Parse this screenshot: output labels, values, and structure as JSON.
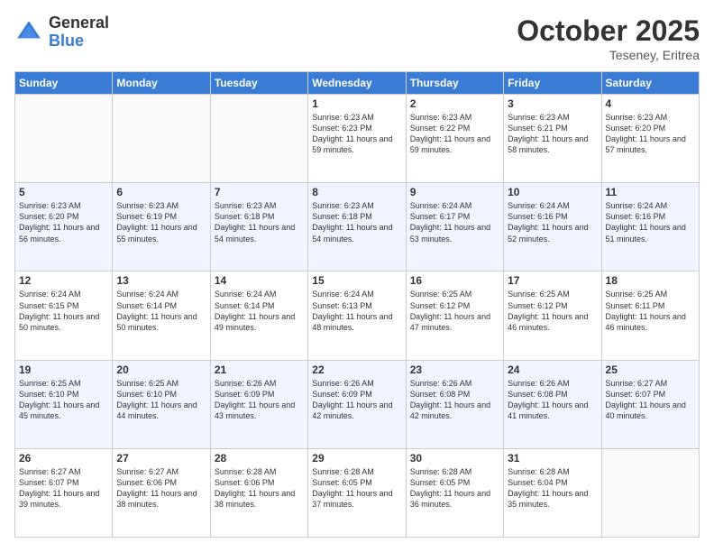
{
  "header": {
    "logo_general": "General",
    "logo_blue": "Blue",
    "month_title": "October 2025",
    "location": "Teseney, Eritrea"
  },
  "weekdays": [
    "Sunday",
    "Monday",
    "Tuesday",
    "Wednesday",
    "Thursday",
    "Friday",
    "Saturday"
  ],
  "weeks": [
    [
      {
        "day": "",
        "info": ""
      },
      {
        "day": "",
        "info": ""
      },
      {
        "day": "",
        "info": ""
      },
      {
        "day": "1",
        "info": "Sunrise: 6:23 AM\nSunset: 6:23 PM\nDaylight: 11 hours\nand 59 minutes."
      },
      {
        "day": "2",
        "info": "Sunrise: 6:23 AM\nSunset: 6:22 PM\nDaylight: 11 hours\nand 59 minutes."
      },
      {
        "day": "3",
        "info": "Sunrise: 6:23 AM\nSunset: 6:21 PM\nDaylight: 11 hours\nand 58 minutes."
      },
      {
        "day": "4",
        "info": "Sunrise: 6:23 AM\nSunset: 6:20 PM\nDaylight: 11 hours\nand 57 minutes."
      }
    ],
    [
      {
        "day": "5",
        "info": "Sunrise: 6:23 AM\nSunset: 6:20 PM\nDaylight: 11 hours\nand 56 minutes."
      },
      {
        "day": "6",
        "info": "Sunrise: 6:23 AM\nSunset: 6:19 PM\nDaylight: 11 hours\nand 55 minutes."
      },
      {
        "day": "7",
        "info": "Sunrise: 6:23 AM\nSunset: 6:18 PM\nDaylight: 11 hours\nand 54 minutes."
      },
      {
        "day": "8",
        "info": "Sunrise: 6:23 AM\nSunset: 6:18 PM\nDaylight: 11 hours\nand 54 minutes."
      },
      {
        "day": "9",
        "info": "Sunrise: 6:24 AM\nSunset: 6:17 PM\nDaylight: 11 hours\nand 53 minutes."
      },
      {
        "day": "10",
        "info": "Sunrise: 6:24 AM\nSunset: 6:16 PM\nDaylight: 11 hours\nand 52 minutes."
      },
      {
        "day": "11",
        "info": "Sunrise: 6:24 AM\nSunset: 6:16 PM\nDaylight: 11 hours\nand 51 minutes."
      }
    ],
    [
      {
        "day": "12",
        "info": "Sunrise: 6:24 AM\nSunset: 6:15 PM\nDaylight: 11 hours\nand 50 minutes."
      },
      {
        "day": "13",
        "info": "Sunrise: 6:24 AM\nSunset: 6:14 PM\nDaylight: 11 hours\nand 50 minutes."
      },
      {
        "day": "14",
        "info": "Sunrise: 6:24 AM\nSunset: 6:14 PM\nDaylight: 11 hours\nand 49 minutes."
      },
      {
        "day": "15",
        "info": "Sunrise: 6:24 AM\nSunset: 6:13 PM\nDaylight: 11 hours\nand 48 minutes."
      },
      {
        "day": "16",
        "info": "Sunrise: 6:25 AM\nSunset: 6:12 PM\nDaylight: 11 hours\nand 47 minutes."
      },
      {
        "day": "17",
        "info": "Sunrise: 6:25 AM\nSunset: 6:12 PM\nDaylight: 11 hours\nand 46 minutes."
      },
      {
        "day": "18",
        "info": "Sunrise: 6:25 AM\nSunset: 6:11 PM\nDaylight: 11 hours\nand 46 minutes."
      }
    ],
    [
      {
        "day": "19",
        "info": "Sunrise: 6:25 AM\nSunset: 6:10 PM\nDaylight: 11 hours\nand 45 minutes."
      },
      {
        "day": "20",
        "info": "Sunrise: 6:25 AM\nSunset: 6:10 PM\nDaylight: 11 hours\nand 44 minutes."
      },
      {
        "day": "21",
        "info": "Sunrise: 6:26 AM\nSunset: 6:09 PM\nDaylight: 11 hours\nand 43 minutes."
      },
      {
        "day": "22",
        "info": "Sunrise: 6:26 AM\nSunset: 6:09 PM\nDaylight: 11 hours\nand 42 minutes."
      },
      {
        "day": "23",
        "info": "Sunrise: 6:26 AM\nSunset: 6:08 PM\nDaylight: 11 hours\nand 42 minutes."
      },
      {
        "day": "24",
        "info": "Sunrise: 6:26 AM\nSunset: 6:08 PM\nDaylight: 11 hours\nand 41 minutes."
      },
      {
        "day": "25",
        "info": "Sunrise: 6:27 AM\nSunset: 6:07 PM\nDaylight: 11 hours\nand 40 minutes."
      }
    ],
    [
      {
        "day": "26",
        "info": "Sunrise: 6:27 AM\nSunset: 6:07 PM\nDaylight: 11 hours\nand 39 minutes."
      },
      {
        "day": "27",
        "info": "Sunrise: 6:27 AM\nSunset: 6:06 PM\nDaylight: 11 hours\nand 38 minutes."
      },
      {
        "day": "28",
        "info": "Sunrise: 6:28 AM\nSunset: 6:06 PM\nDaylight: 11 hours\nand 38 minutes."
      },
      {
        "day": "29",
        "info": "Sunrise: 6:28 AM\nSunset: 6:05 PM\nDaylight: 11 hours\nand 37 minutes."
      },
      {
        "day": "30",
        "info": "Sunrise: 6:28 AM\nSunset: 6:05 PM\nDaylight: 11 hours\nand 36 minutes."
      },
      {
        "day": "31",
        "info": "Sunrise: 6:28 AM\nSunset: 6:04 PM\nDaylight: 11 hours\nand 35 minutes."
      },
      {
        "day": "",
        "info": ""
      }
    ]
  ]
}
